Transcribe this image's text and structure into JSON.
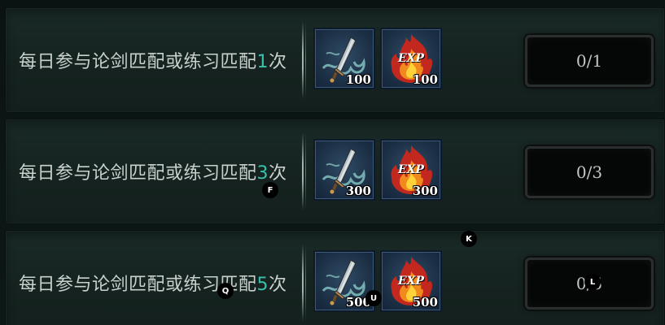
{
  "quests": [
    {
      "text_prefix": "每日参与论剑匹配或练习匹配",
      "count": "1",
      "text_suffix": "次",
      "rewards": [
        {
          "icon": "sword-icon",
          "quantity": "100"
        },
        {
          "icon": "exp-flame-icon",
          "quantity": "100"
        }
      ],
      "progress": "0/1"
    },
    {
      "text_prefix": "每日参与论剑匹配或练习匹配",
      "count": "3",
      "text_suffix": "次",
      "rewards": [
        {
          "icon": "sword-icon",
          "quantity": "300"
        },
        {
          "icon": "exp-flame-icon",
          "quantity": "300"
        }
      ],
      "progress": "0/3"
    },
    {
      "text_prefix": "每日参与论剑匹配或练习匹配",
      "count": "5",
      "text_suffix": "次",
      "rewards": [
        {
          "icon": "sword-icon",
          "quantity": "500"
        },
        {
          "icon": "exp-flame-icon",
          "quantity": "500"
        }
      ],
      "progress": "0/5"
    }
  ],
  "exp_badge": "EXP",
  "markers": [
    "F",
    "K",
    "Q",
    "U",
    "L"
  ],
  "colors": {
    "count_highlight": "#38c2ad",
    "row_bg": "#1a2a27",
    "reward_bg": "#1a2d42",
    "progress_bg": "#050606"
  }
}
